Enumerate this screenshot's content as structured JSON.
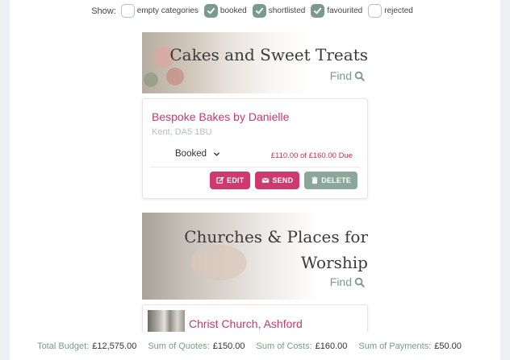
{
  "filters": {
    "show_label": "Show:",
    "items": [
      {
        "label": "empty categories",
        "checked": false
      },
      {
        "label": "booked",
        "checked": true
      },
      {
        "label": "shortlisted",
        "checked": true
      },
      {
        "label": "favourited",
        "checked": true
      },
      {
        "label": "rejected",
        "checked": false
      }
    ]
  },
  "categories": [
    {
      "title": "Cakes and Sweet Treats",
      "find_label": "Find",
      "suppliers": [
        {
          "name": "Bespoke Bakes by Danielle",
          "location": "Kent, DA5 1BU",
          "status": "Booked",
          "due": "£110.00 of £160.00 Due",
          "edit_label": "EDIT",
          "send_label": "SEND",
          "delete_label": "DELETE"
        }
      ]
    },
    {
      "title_line1": "Churches & Places for",
      "title_line2": "Worship",
      "find_label": "Find",
      "suppliers": [
        {
          "name": "Christ Church, Ashford"
        }
      ]
    }
  ],
  "totals": {
    "budget_label": "Total Budget:",
    "budget_value": "£12,575.00",
    "quotes_label": "Sum of Quotes:",
    "quotes_value": "£150.00",
    "costs_label": "Sum of Costs:",
    "costs_value": "£160.00",
    "payments_label": "Sum of Payments:",
    "payments_value": "£50.00"
  },
  "colors": {
    "accent_pink": "#cf3a6e",
    "accent_green": "#7a9a8c",
    "due_red": "#d0304a"
  }
}
